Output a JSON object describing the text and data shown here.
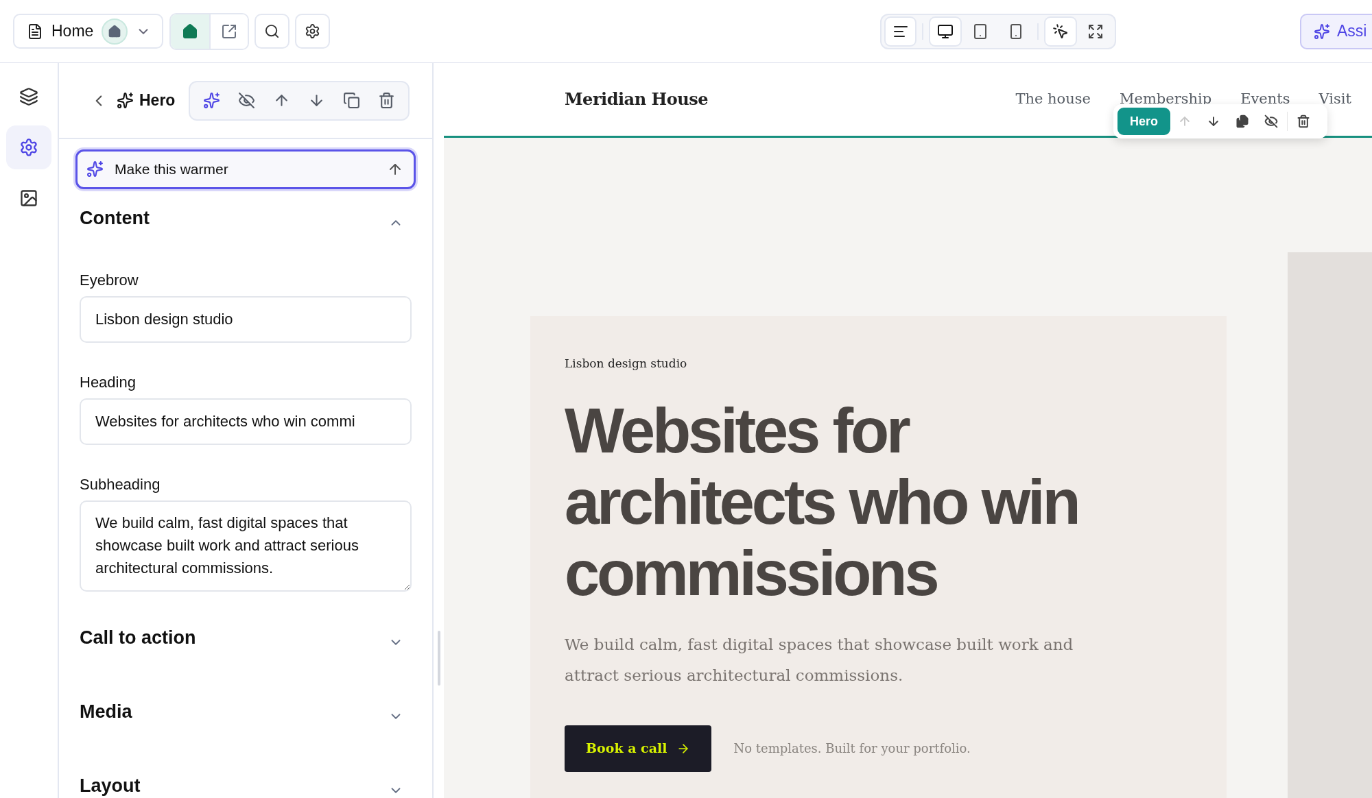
{
  "top_bar": {
    "page_selector": {
      "label": "Home"
    },
    "page_actions": [
      {
        "kind": "home",
        "selected": true
      },
      {
        "kind": "open_external",
        "selected": false
      }
    ],
    "tools": [
      {
        "kind": "search"
      },
      {
        "kind": "settings"
      }
    ],
    "text_toggle": {
      "on": true
    },
    "devices": [
      {
        "kind": "desktop",
        "selected": true
      },
      {
        "kind": "tablet",
        "selected": false
      },
      {
        "kind": "mobile",
        "selected": false
      }
    ],
    "select_toggle": {
      "on": true
    },
    "fullscreen_toggle": {
      "on": false
    },
    "assistant_button": {
      "label": "Assi"
    }
  },
  "rail": [
    {
      "kind": "layers",
      "selected": false
    },
    {
      "kind": "settings",
      "selected": true
    },
    {
      "kind": "media",
      "selected": false
    }
  ],
  "panel": {
    "title": "Hero",
    "actions": [
      {
        "kind": "ai"
      },
      {
        "kind": "hide"
      },
      {
        "kind": "move_up"
      },
      {
        "kind": "move_down"
      },
      {
        "kind": "duplicate"
      },
      {
        "kind": "delete"
      }
    ],
    "prompt": {
      "value": "Make this warmer"
    },
    "sections": [
      {
        "title": "Content",
        "expanded": true,
        "fields": [
          {
            "label": "Eyebrow",
            "kind": "input",
            "value": "Lisbon design studio"
          },
          {
            "label": "Heading",
            "kind": "input",
            "value": "Websites for architects who win commi"
          },
          {
            "label": "Subheading",
            "kind": "textarea",
            "value": "We build calm, fast digital spaces that showcase built work and attract serious architectural commissions."
          }
        ]
      },
      {
        "title": "Call to action",
        "expanded": false
      },
      {
        "title": "Media",
        "expanded": false
      },
      {
        "title": "Layout",
        "expanded": false
      }
    ]
  },
  "preview": {
    "brand": "Meridian House",
    "nav": [
      "The house",
      "Membership",
      "Events",
      "Visit"
    ],
    "selection_toolbar": {
      "label": "Hero",
      "actions": [
        {
          "kind": "move_up",
          "disabled": true
        },
        {
          "kind": "move_down",
          "disabled": false
        },
        {
          "kind": "duplicate",
          "disabled": false
        },
        {
          "kind": "hide",
          "disabled": false
        },
        {
          "kind": "delete",
          "disabled": false
        }
      ]
    },
    "hero": {
      "eyebrow": "Lisbon design studio",
      "heading": "Websites for architects who win commissions",
      "subheading": "We build calm, fast digital spaces that showcase built work and attract serious architectural commissions.",
      "cta": "Book a call",
      "note": "No templates. Built for your portfolio."
    }
  }
}
